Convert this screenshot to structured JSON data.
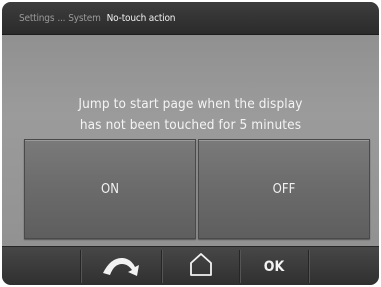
{
  "header": {
    "breadcrumb_parent": "Settings",
    "breadcrumb_separator": "...",
    "breadcrumb_current": "System",
    "title": "No-touch action"
  },
  "message": {
    "line1": "Jump to start page when the display",
    "line2": "has not been touched for 5 minutes"
  },
  "options": {
    "on_label": "ON",
    "off_label": "OFF"
  },
  "navbar": {
    "back_icon": "back-arrow-icon",
    "home_icon": "home-icon",
    "ok_label": "OK"
  },
  "colors": {
    "titlebar": "#333333",
    "background": "#939393",
    "button": "#6c6c6c",
    "text": "#f4f4f4"
  }
}
